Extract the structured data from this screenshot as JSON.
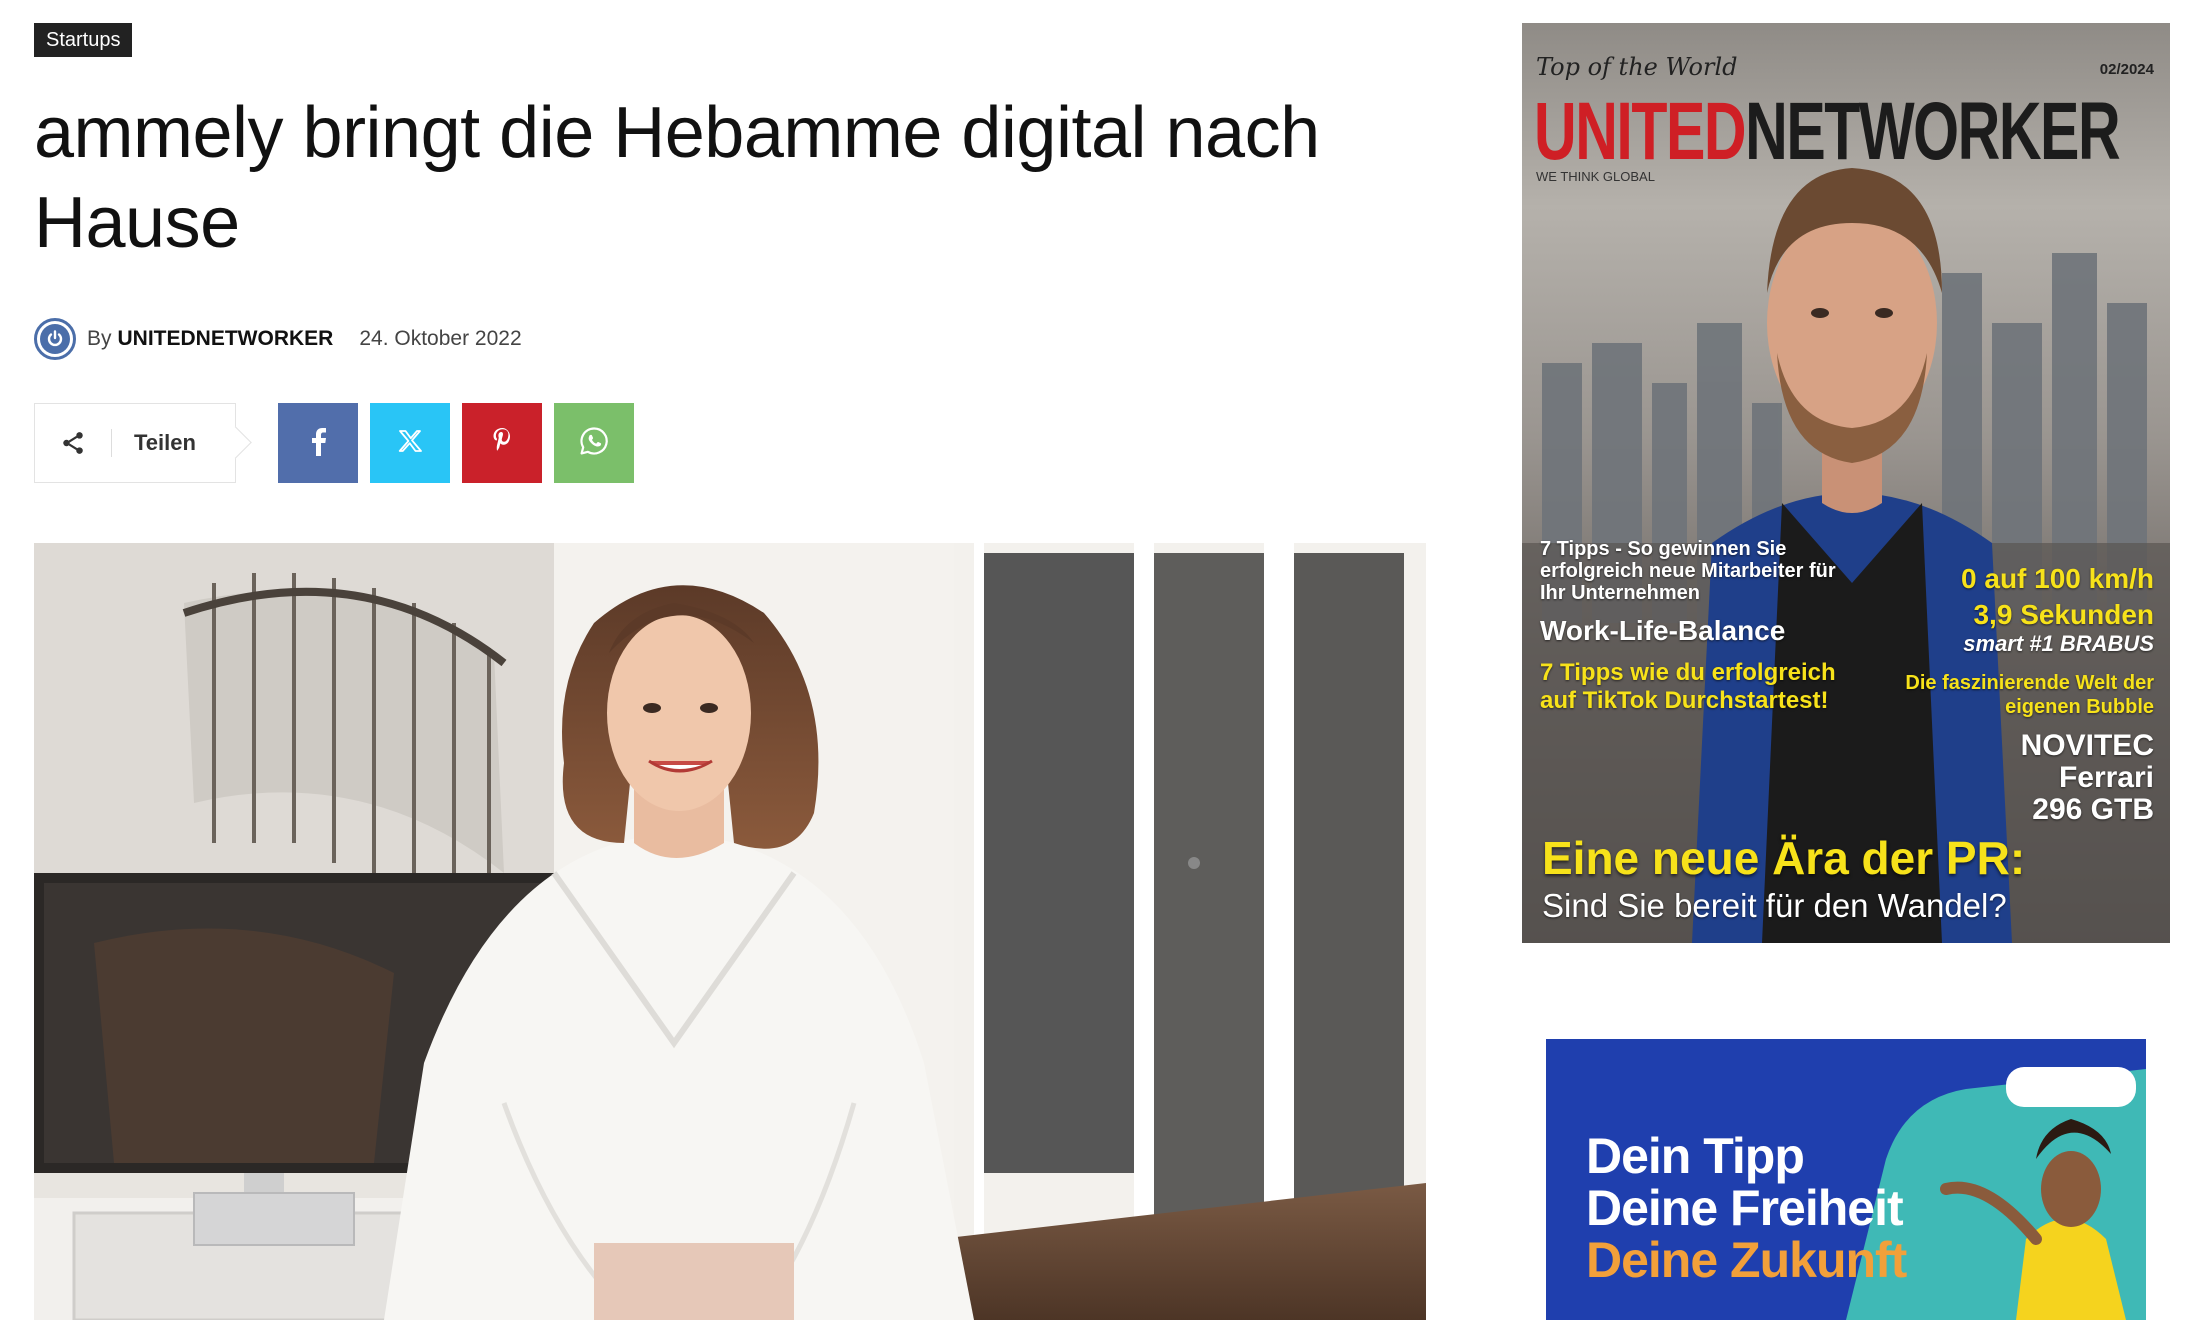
{
  "article": {
    "category": "Startups",
    "title": "ammely bringt die Hebamme digital nach Hause",
    "by_label": "By",
    "author": "UNITEDNETWORKER",
    "date": "24. Oktober 2022"
  },
  "share": {
    "label": "Teilen",
    "buttons": [
      {
        "icon": "facebook-icon",
        "color": "#516eab"
      },
      {
        "icon": "x-icon",
        "color": "#29c5f6"
      },
      {
        "icon": "pinterest-icon",
        "color": "#ca212a"
      },
      {
        "icon": "whatsapp-icon",
        "color": "#7bbf6a"
      }
    ]
  },
  "hero": {
    "icon": "hero-photo"
  },
  "sidebar": {
    "magazine": {
      "top_line": "Top of the World",
      "issue": "02/2024",
      "brand_red": "UNITED",
      "brand_dark": "NETWORKER",
      "tagline": "WE THINK GLOBAL",
      "tips_1": "7 Tipps - So gewinnen Sie erfolgreich neue Mitarbeiter für Ihr Unternehmen",
      "work_life": "Work-Life-Balance",
      "tips_2": "7 Tipps wie du erfolgreich auf TikTok Durchstartest!",
      "speed_1": "0 auf 100 km/h",
      "speed_2": "3,9 Sekunden",
      "speed_3": "smart #1 BRABUS",
      "bubble": "Die faszinierende Welt der eigenen Bubble",
      "car_1": "NOVITEC",
      "car_2": "Ferrari",
      "car_3": "296 GTB",
      "headline": "Eine neue Ära der PR:",
      "subheadline": "Sind Sie bereit für den Wandel?"
    },
    "ad": {
      "line_1": "Dein Tipp",
      "line_2": "Deine Freiheit",
      "line_3": "Deine Zukunft"
    }
  },
  "colors": {
    "tag_bg": "#222222",
    "brand_red": "#cf1f25",
    "mag_yellow": "#f7e21a",
    "ad_blue": "#1f3fae",
    "ad_orange": "#f2a03a"
  }
}
